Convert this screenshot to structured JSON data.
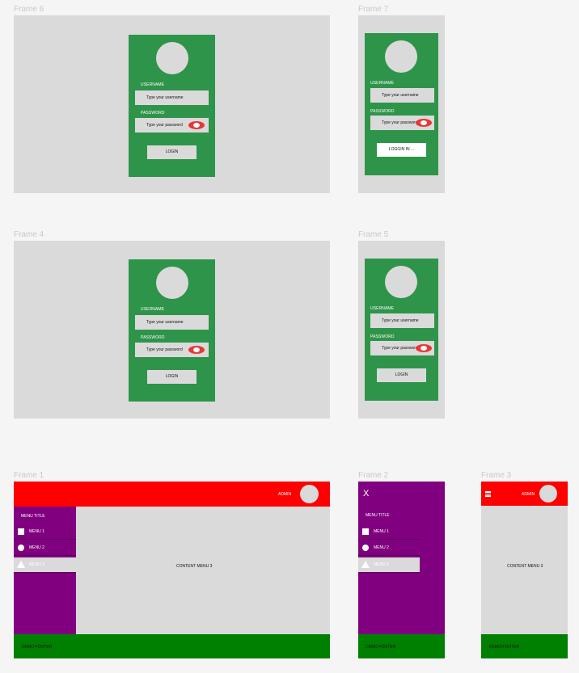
{
  "frames": {
    "f6": {
      "label": "Frame 6"
    },
    "f7": {
      "label": "Frame 7"
    },
    "f4": {
      "label": "Frame 4"
    },
    "f5": {
      "label": "Frame 5"
    },
    "f1": {
      "label": "Frame 1"
    },
    "f2": {
      "label": "Frame 2"
    },
    "f3": {
      "label": "Frame 3"
    }
  },
  "login": {
    "username_label": "USERNAME",
    "username_placeholder": "Type your username",
    "password_label": "PASSWORD",
    "password_placeholder": "Type your password",
    "login_button": "LOGIN",
    "logging_in_button": "LOGGIN IN ..."
  },
  "dashboard": {
    "admin_label": "ADMIN",
    "menu_title": "MENU TITLE",
    "menu_items": [
      "MENU 1",
      "MENU 2",
      "MENU 3"
    ],
    "content_label": "CONTENT MENU 3",
    "footer_label": "DEMO FOOTER",
    "close_symbol": "X"
  },
  "colors": {
    "background": "#f5f5f5",
    "frame_gray": "#dadada",
    "login_green": "#2e944a",
    "header_red": "#ff0000",
    "sidebar_purple": "#800080",
    "footer_green": "#008000",
    "eye_red": "#e53935"
  },
  "icons": {
    "eye": "eye-toggle-icon",
    "menu_1": "square-icon",
    "menu_2": "circle-icon",
    "menu_3": "triangle-icon",
    "close": "close-icon",
    "hamburger": "hamburger-icon"
  }
}
